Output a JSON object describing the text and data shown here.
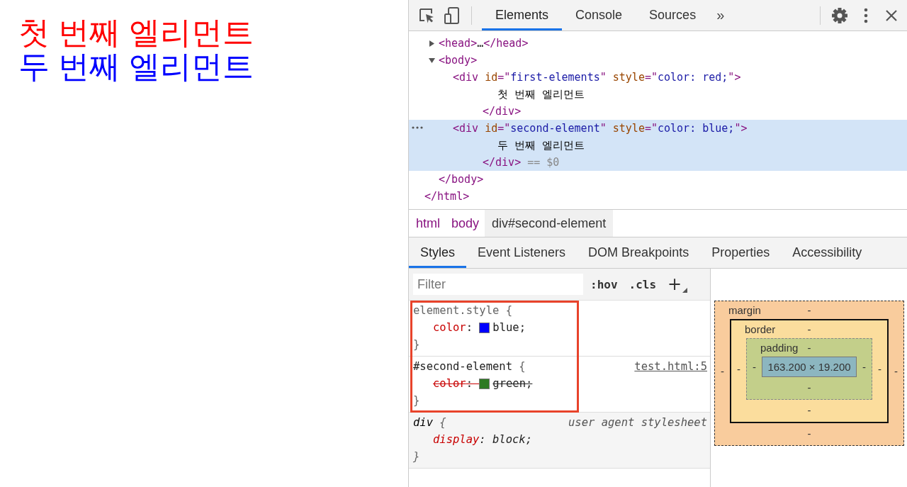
{
  "page": {
    "lines": [
      {
        "text": "첫 번째 엘리먼트",
        "color": "#ff0000"
      },
      {
        "text": "두 번째 엘리먼트",
        "color": "#0000ff"
      }
    ]
  },
  "devtools": {
    "tabs": [
      {
        "label": "Elements",
        "selected": true
      },
      {
        "label": "Console",
        "selected": false
      },
      {
        "label": "Sources",
        "selected": false
      }
    ],
    "overflow": "»",
    "dom_tree": [
      {
        "kind": "element",
        "selected": false,
        "close": [
          {
            "kind": "tag",
            "text": "</html>"
          }
        ],
        "children": [
          {
            "kind": "element",
            "selected": false,
            "expanded": false,
            "tokens": [
              {
                "kind": "tag",
                "text": "<head>"
              },
              {
                "kind": "text",
                "text": "…"
              },
              {
                "kind": "tag",
                "text": "</head>"
              }
            ]
          },
          {
            "kind": "element",
            "selected": false,
            "expanded": true,
            "tokens": [
              {
                "kind": "tag",
                "text": "<body>"
              }
            ],
            "close": [
              {
                "kind": "tag",
                "text": "</body>"
              }
            ],
            "children": [
              {
                "kind": "element",
                "selected": false,
                "tokens": [
                  {
                    "kind": "tag",
                    "text": "<div"
                  },
                  {
                    "kind": "attr",
                    "text": " id"
                  },
                  {
                    "kind": "punct",
                    "text": "=\""
                  },
                  {
                    "kind": "value",
                    "text": "first-elements"
                  },
                  {
                    "kind": "punct",
                    "text": "\""
                  },
                  {
                    "kind": "attr",
                    "text": " style"
                  },
                  {
                    "kind": "punct",
                    "text": "=\""
                  },
                  {
                    "kind": "value",
                    "text": "color: red;"
                  },
                  {
                    "kind": "punct",
                    "text": "\""
                  },
                  {
                    "kind": "tag",
                    "text": ">"
                  }
                ],
                "close": [
                  {
                    "kind": "tag",
                    "text": "</div>"
                  }
                ],
                "children": [
                  {
                    "kind": "text",
                    "text": "첫 번째 엘리먼트"
                  }
                ]
              },
              {
                "kind": "element",
                "selected": true,
                "tokens": [
                  {
                    "kind": "tag",
                    "text": "<div"
                  },
                  {
                    "kind": "attr",
                    "text": " id"
                  },
                  {
                    "kind": "punct",
                    "text": "=\""
                  },
                  {
                    "kind": "value",
                    "text": "second-element"
                  },
                  {
                    "kind": "punct",
                    "text": "\""
                  },
                  {
                    "kind": "attr",
                    "text": " style"
                  },
                  {
                    "kind": "punct",
                    "text": "=\""
                  },
                  {
                    "kind": "value",
                    "text": "color: blue;"
                  },
                  {
                    "kind": "punct",
                    "text": "\""
                  },
                  {
                    "kind": "tag",
                    "text": ">"
                  }
                ],
                "close": [
                  {
                    "kind": "tag",
                    "text": "</div>"
                  },
                  {
                    "kind": "marker",
                    "text": " == $0"
                  }
                ],
                "children": [
                  {
                    "kind": "text",
                    "text": "두 번째 엘리먼트"
                  }
                ]
              }
            ]
          }
        ]
      }
    ],
    "breadcrumbs": [
      {
        "label": "html",
        "selected": false
      },
      {
        "label": "body",
        "selected": false
      },
      {
        "label": "div#second-element",
        "selected": true
      }
    ],
    "subtabs": [
      {
        "label": "Styles",
        "selected": true
      },
      {
        "label": "Event Listeners",
        "selected": false
      },
      {
        "label": "DOM Breakpoints",
        "selected": false
      },
      {
        "label": "Properties",
        "selected": false
      },
      {
        "label": "Accessibility",
        "selected": false
      }
    ],
    "styles": {
      "filter": {
        "placeholder": "Filter"
      },
      "buttons": [
        ":hov",
        ".cls",
        "+"
      ],
      "rules": [
        {
          "kind": "inline",
          "selector": "element.style",
          "brace_open": "{",
          "brace_close": "}",
          "highlighted": true,
          "declarations": [
            {
              "name": "color",
              "colon": ":",
              "value": "blue;",
              "color": "#0000ff",
              "overridden": false
            }
          ]
        },
        {
          "kind": "author",
          "selector": "#second-element",
          "source": "test.html:5",
          "brace_open": "{",
          "brace_close": "}",
          "highlighted": true,
          "declarations": [
            {
              "name": "color",
              "colon": ":",
              "value": "green;",
              "color": "#2e7a24",
              "overridden": true
            }
          ]
        },
        {
          "kind": "user_agent",
          "selector": "div",
          "source": "user agent stylesheet",
          "brace_open": "{",
          "brace_close": "}",
          "highlighted": false,
          "declarations": [
            {
              "name": "display",
              "colon": ":",
              "value": "block;",
              "overridden": false
            }
          ]
        }
      ]
    },
    "box_model": {
      "margin": {
        "label": "margin",
        "top": "-",
        "left": "-",
        "right": "-",
        "bottom": "-"
      },
      "border": {
        "label": "border",
        "top": "-",
        "left": "-",
        "right": "-",
        "bottom": "-"
      },
      "padding": {
        "label": "padding",
        "top": "-",
        "left": "-",
        "right": "-",
        "bottom": "-"
      },
      "content": "163.200 × 19.200"
    }
  }
}
